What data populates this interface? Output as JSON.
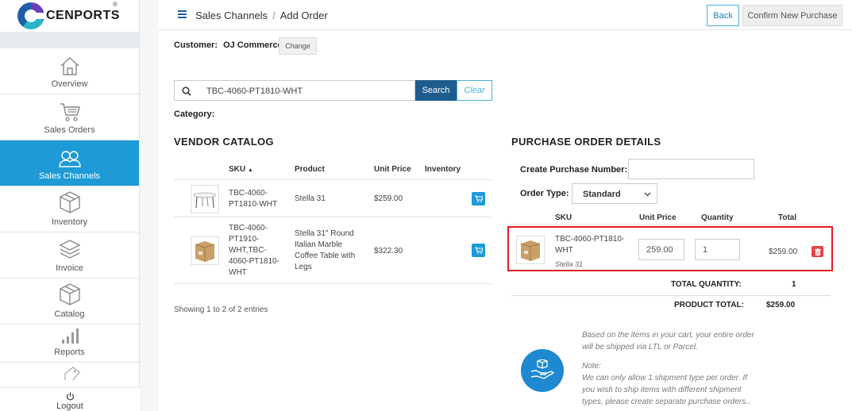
{
  "brand": {
    "name": "CENPORTS",
    "reg": "®"
  },
  "sidebar": {
    "items": [
      {
        "label": "Overview",
        "icon": "home-icon"
      },
      {
        "label": "Sales Orders",
        "icon": "cart-icon"
      },
      {
        "label": "Sales Channels",
        "icon": "users-icon",
        "active": true
      },
      {
        "label": "Inventory",
        "icon": "box-icon"
      },
      {
        "label": "Invoice",
        "icon": "layers-icon"
      },
      {
        "label": "Catalog",
        "icon": "box-icon"
      },
      {
        "label": "Reports",
        "icon": "bar-chart-icon"
      },
      {
        "label": "Logout",
        "icon": "power-icon"
      }
    ]
  },
  "header": {
    "crumb_parent": "Sales Channels",
    "crumb_separator": "/",
    "crumb_current": "Add Order",
    "back_label": "Back",
    "confirm_label": "Confirm New Purchase"
  },
  "customer": {
    "label": "Customer:",
    "name": "OJ Commerce",
    "change_label": "Change"
  },
  "search": {
    "value": "TBC-4060-PT1810-WHT",
    "button_label": "Search",
    "clear_label": "Clear"
  },
  "category_label": "Category:",
  "vendor_catalog": {
    "title": "VENDOR CATALOG",
    "columns": {
      "sku": "SKU",
      "sort_indicator": "▲",
      "product": "Product",
      "unit_price": "Unit Price",
      "inventory": "Inventory"
    },
    "rows": [
      {
        "sku_lines": [
          "TBC-4060-",
          "PT1810-WHT"
        ],
        "product_lines": [
          "Stella 31"
        ],
        "price": "$259.00"
      },
      {
        "sku_lines": [
          "TBC-4060-",
          "PT1910-",
          "WHT,TBC-",
          "4060-PT1810-",
          "WHT"
        ],
        "product_lines": [
          "Stella 31\" Round",
          "Italian Marble",
          "Coffee Table with",
          "Legs"
        ],
        "price": "$322.30"
      }
    ],
    "showing": "Showing 1 to 2 of 2 entries"
  },
  "po": {
    "title": "PURCHASE ORDER DETAILS",
    "create_number_label": "Create Purchase Number:",
    "order_type_label": "Order Type:",
    "order_type_value": "Standard",
    "columns": {
      "sku": "SKU",
      "unit_price": "Unit Price",
      "quantity": "Quantity",
      "total": "Total"
    },
    "line": {
      "sku_lines": [
        "TBC-4060-PT1810-",
        "WHT"
      ],
      "name": "Stella 31",
      "unit_price": "259.00",
      "quantity": "1",
      "total": "$259.00"
    },
    "total_quantity_label": "TOTAL QUANTITY:",
    "total_quantity": "1",
    "product_total_label": "PRODUCT TOTAL:",
    "product_total": "$259.00"
  },
  "shipping_note": {
    "line1": "Based on the items in your cart, your entire order",
    "line2": "will be shipped via LTL or Parcel.",
    "note_label": "Note:",
    "note1": "We can only allow 1 shipment type per order. If",
    "note2": "you wish to ship items with different shipment",
    "note3": "types, please create separate purchase orders.."
  },
  "colors": {
    "accent": "#1e9bd7",
    "primary_dark": "#1e5c8e",
    "danger": "#e64545",
    "highlight": "#e02020"
  }
}
